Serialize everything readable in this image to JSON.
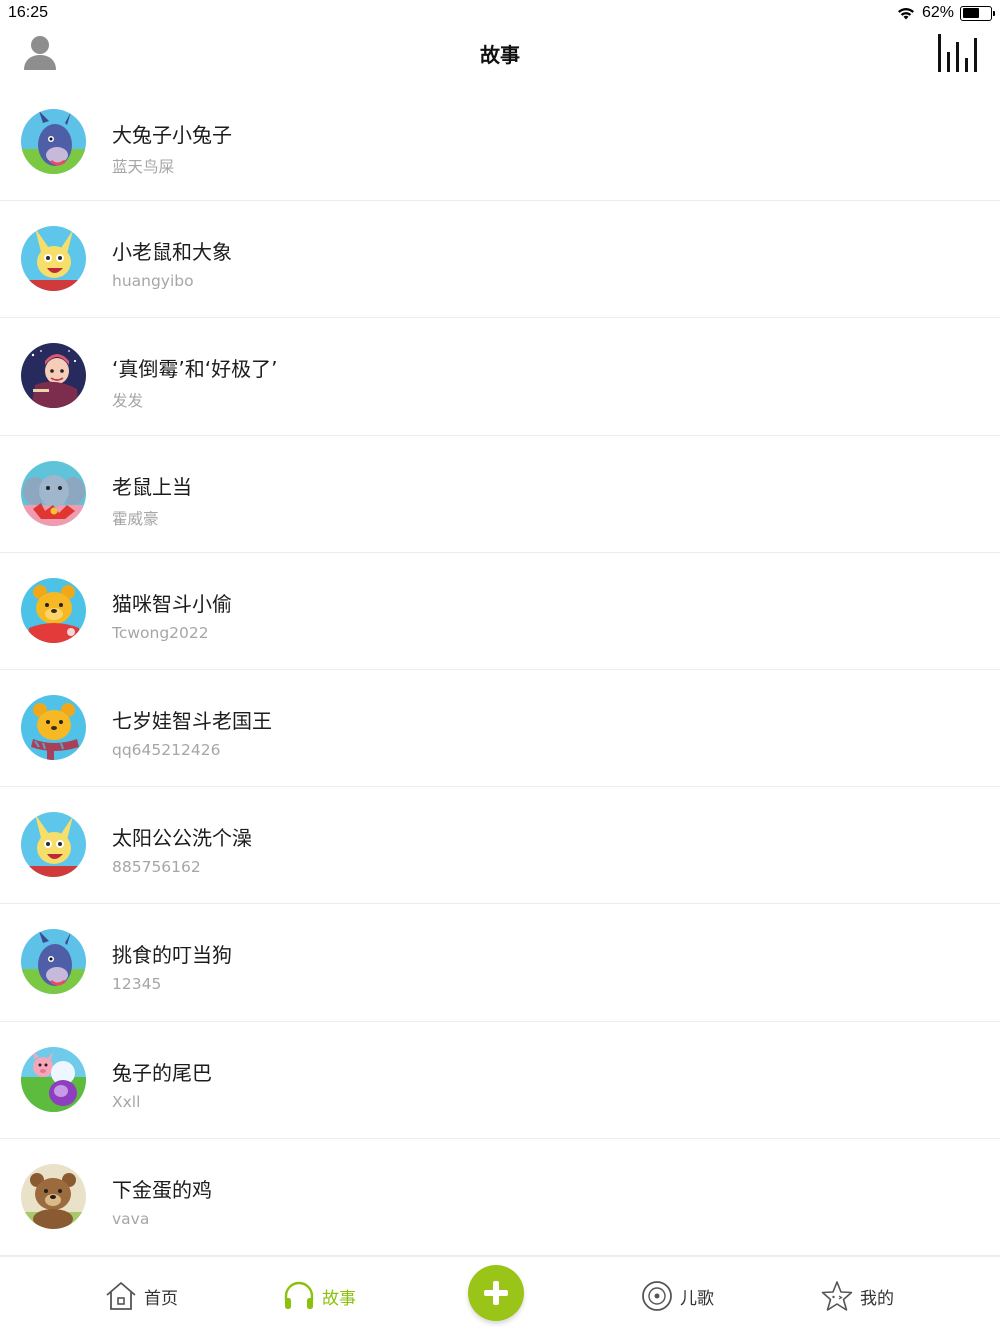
{
  "status_bar": {
    "time": "16:25",
    "battery": "62%",
    "battery_level": 0.62,
    "icons": [
      "wifi-icon",
      "battery-icon"
    ]
  },
  "nav": {
    "title": "故事",
    "left_icon": "user-avatar-icon",
    "right_icon": "equalizer-icon"
  },
  "stories": [
    {
      "title": "大兔子小兔子",
      "author": "蓝天鸟屎",
      "avatar": "eeyore"
    },
    {
      "title": "小老鼠和大象",
      "author": "huangyibo",
      "avatar": "rabbit"
    },
    {
      "title": "‘真倒霉’和‘好极了’",
      "author": "发发",
      "avatar": "night-girl"
    },
    {
      "title": "老鼠上当",
      "author": "霍威豪",
      "avatar": "elephant"
    },
    {
      "title": "猫咪智斗小偷",
      "author": "Tcwong2022",
      "avatar": "pooh"
    },
    {
      "title": "七岁娃智斗老国王",
      "author": "qq645212426",
      "avatar": "pooh-scarf"
    },
    {
      "title": "太阳公公洗个澡",
      "author": "885756162",
      "avatar": "rabbit"
    },
    {
      "title": "挑食的叮当狗",
      "author": "12345",
      "avatar": "eeyore"
    },
    {
      "title": "兔子的尾巴",
      "author": "Xxll",
      "avatar": "piglet"
    },
    {
      "title": "下金蛋的鸡",
      "author": "vava",
      "avatar": "bear"
    }
  ],
  "tab_bar": {
    "tabs": [
      {
        "label": "首页",
        "icon": "home-icon",
        "active": false
      },
      {
        "label": "故事",
        "icon": "headphones-icon",
        "active": true
      },
      {
        "label": "儿歌",
        "icon": "music-disc-icon",
        "active": false
      },
      {
        "label": "我的",
        "icon": "star-face-icon",
        "active": false
      }
    ],
    "add_icon": "plus-icon"
  },
  "colors": {
    "accent": "#8bc10b",
    "add_button": "#9ac417",
    "author_text": "#a6a6a6",
    "divider": "#ececec"
  }
}
